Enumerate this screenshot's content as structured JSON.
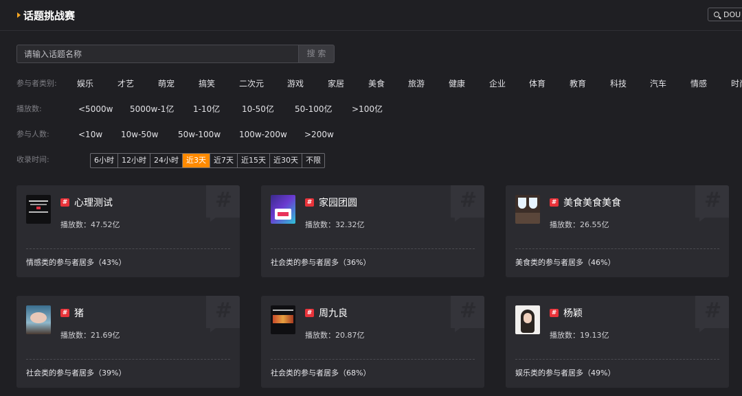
{
  "header": {
    "title": "话题挑战赛",
    "lang_button": "DOU"
  },
  "search": {
    "placeholder": "请输入话题名称",
    "button": "搜 索"
  },
  "filters": {
    "category": {
      "label": "参与者类别:",
      "options": [
        "娱乐",
        "才艺",
        "萌宠",
        "搞笑",
        "二次元",
        "游戏",
        "家居",
        "美食",
        "旅游",
        "健康",
        "企业",
        "体育",
        "教育",
        "科技",
        "汽车",
        "情感",
        "时尚"
      ]
    },
    "plays": {
      "label": "播放数:",
      "options": [
        "<5000w",
        "5000w-1亿",
        "1-10亿",
        "10-50亿",
        "50-100亿",
        ">100亿"
      ]
    },
    "participants": {
      "label": "参与人数:",
      "options": [
        "<10w",
        "10w-50w",
        "50w-100w",
        "100w-200w",
        ">200w"
      ]
    },
    "time": {
      "label": "收录时间:",
      "options": [
        "6小时",
        "12小时",
        "24小时",
        "近3天",
        "近7天",
        "近15天",
        "近30天",
        "不限"
      ],
      "active": "近3天"
    }
  },
  "cards": [
    {
      "name": "心理测试",
      "tag": "#",
      "plays_label": "播放数：",
      "plays": "47.52亿",
      "summary": "情感类的参与者居多（43%）",
      "thumb": "quiz-thumbnail"
    },
    {
      "name": "家园团圆",
      "tag": "#",
      "plays_label": "播放数：",
      "plays": "32.32亿",
      "summary": "社会类的参与者居多（36%）",
      "thumb": "reunion-thumbnail"
    },
    {
      "name": "美食美食美食",
      "tag": "#",
      "plays_label": "播放数：",
      "plays": "26.55亿",
      "summary": "美食类的参与者居多（46%）",
      "thumb": "food-thumbnail"
    },
    {
      "name": "猪",
      "tag": "#",
      "plays_label": "播放数：",
      "plays": "21.69亿",
      "summary": "社会类的参与者居多（39%）",
      "thumb": "pig-thumbnail"
    },
    {
      "name": "周九良",
      "tag": "#",
      "plays_label": "播放数：",
      "plays": "20.87亿",
      "summary": "社会类的参与者居多（68%）",
      "thumb": "show-thumbnail"
    },
    {
      "name": "杨颖",
      "tag": "#",
      "plays_label": "播放数：",
      "plays": "19.13亿",
      "summary": "娱乐类的参与者居多（49%）",
      "thumb": "portrait-thumbnail"
    }
  ],
  "colors": {
    "accent": "#ff8a00",
    "tag": "#e8333a",
    "background": "#1f1f23",
    "card": "#2b2b30"
  }
}
